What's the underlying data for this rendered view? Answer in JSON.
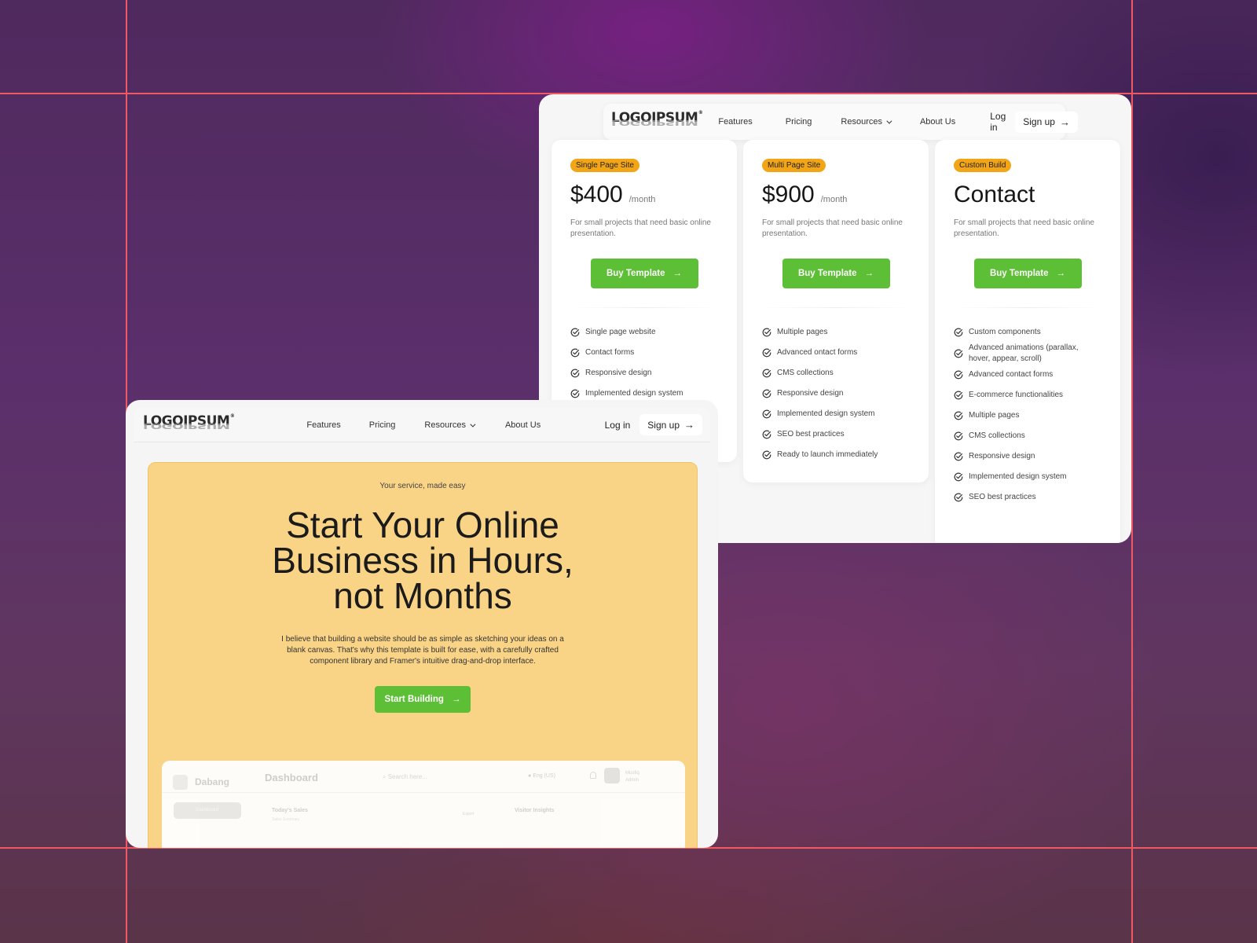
{
  "pricing_window": {
    "nav": {
      "logo": "LOGOIPSUM",
      "links": [
        "Features",
        "Pricing",
        "Resources",
        "About Us"
      ],
      "login": "Log in",
      "signup": "Sign up"
    },
    "cards": [
      {
        "badge": "Single Page Site",
        "price": "$400",
        "period": "/month",
        "description": "For small projects that need basic online presentation.",
        "button": "Buy Template",
        "features": [
          "Single page website",
          "Contact forms",
          "Responsive design",
          "Implemented design system"
        ]
      },
      {
        "badge": "Multi Page Site",
        "price": "$900",
        "period": "/month",
        "description": "For small projects that need basic online presentation.",
        "button": "Buy Template",
        "features": [
          "Multiple pages",
          "Advanced ontact forms",
          "CMS collections",
          "Responsive design",
          "Implemented design system",
          "SEO best practices",
          "Ready to launch immediately"
        ]
      },
      {
        "badge": "Custom Build",
        "price": "Contact",
        "period": "",
        "description": "For small projects that need basic online presentation.",
        "button": "Buy Template",
        "features": [
          "Custom components",
          "Advanced animations (parallax, hover, appear, scroll)",
          "Advanced contact forms",
          "E-commerce functionalities",
          "Multiple pages",
          "CMS collections",
          "Responsive design",
          "Implemented design system",
          "SEO best practices"
        ]
      }
    ]
  },
  "hero_window": {
    "nav": {
      "logo": "LOGOIPSUM",
      "links": [
        "Features",
        "Pricing",
        "Resources",
        "About Us"
      ],
      "login": "Log in",
      "signup": "Sign up"
    },
    "eyebrow": "Your service, made easy",
    "title": "Start Your Online Business in Hours, not Months",
    "subtitle": "I believe that building a website should be as simple as sketching your ideas on a blank canvas. That's why this template is built for ease, with a carefully crafted component library and Framer's intuitive drag-and-drop interface.",
    "cta": "Start Building",
    "dashboard_preview": {
      "brand": "Dabang",
      "title": "Dashboard",
      "search_placeholder": "Search here...",
      "language": "Eng (US)",
      "user_name": "Musfiq",
      "user_role": "Admin",
      "sidebar_active": "Dashboard",
      "card_title": "Today's Sales",
      "card_subtitle": "Sales Summary",
      "export": "Export",
      "insights_title": "Visitor Insights"
    }
  },
  "colors": {
    "accent_green": "#5cbf35",
    "badge_orange": "#f2a516",
    "hero_yellow": "#fad486",
    "guide_red": "#ef5a62"
  }
}
